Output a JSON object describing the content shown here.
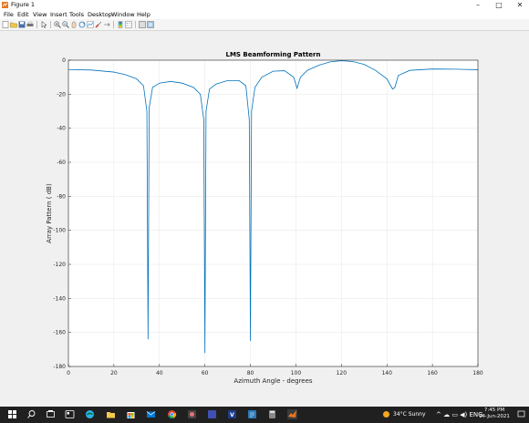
{
  "window": {
    "title": "Figure 1",
    "controls": {
      "minimize": "–",
      "maximize": "□",
      "close": "✕"
    }
  },
  "menu": [
    "File",
    "Edit",
    "View",
    "Insert",
    "Tools",
    "Desktop",
    "Window",
    "Help"
  ],
  "toolbar_icons": [
    "new-figure-icon",
    "open-file-icon",
    "save-icon",
    "print-icon",
    "select-arrow-icon",
    "zoom-in-icon",
    "zoom-out-icon",
    "pan-icon",
    "rotate-3d-icon",
    "data-cursor-icon",
    "brush-icon",
    "link-plot-icon",
    "colorbar-icon",
    "legend-icon",
    "hide-plot-tools-icon",
    "show-plot-tools-icon"
  ],
  "colors": {
    "line": "#0072bd",
    "grid": "#e6e6e6",
    "axes": "#262626",
    "taskbar": "#202020"
  },
  "chart_data": {
    "type": "line",
    "title": "LMS Beamforming Pattern",
    "xlabel": "Azimuth Angle - degrees",
    "ylabel": "Array Pattern ( dB)",
    "xlim": [
      0,
      180
    ],
    "ylim": [
      -180,
      0
    ],
    "xticks": [
      "0",
      "20",
      "40",
      "60",
      "80",
      "100",
      "120",
      "140",
      "160",
      "180"
    ],
    "yticks": [
      "0",
      "-20",
      "-40",
      "-60",
      "-80",
      "-100",
      "-120",
      "-140",
      "-160",
      "-180"
    ],
    "grid": true,
    "series": [
      {
        "x": [
          0,
          10,
          20,
          25,
          30,
          33,
          34.5,
          35,
          35.5,
          37,
          40,
          45,
          50,
          55,
          58,
          59.5,
          60,
          60.5,
          62,
          65,
          70,
          75,
          78,
          79.5,
          80,
          80.5,
          82,
          85,
          90,
          95,
          99,
          100.5,
          102,
          105,
          110,
          115,
          120,
          125,
          130,
          135,
          140,
          142.5,
          143.5,
          145,
          150,
          160,
          170,
          180
        ],
        "y": [
          -5.5,
          -5.8,
          -7,
          -8.5,
          -11,
          -15,
          -30,
          -164,
          -28,
          -16,
          -13.5,
          -12.5,
          -13.5,
          -16,
          -20,
          -35,
          -172,
          -30,
          -17,
          -14,
          -12,
          -12,
          -15,
          -35,
          -165,
          -30,
          -16,
          -10,
          -6.5,
          -6.2,
          -10,
          -16.5,
          -10,
          -6,
          -3,
          -1,
          -0.3,
          -0.8,
          -2.5,
          -6,
          -11,
          -17,
          -16,
          -9,
          -6,
          -5.2,
          -5.3,
          -5.6
        ]
      }
    ]
  },
  "taskbar": {
    "weather": "34°C  Sunny",
    "time": "7:45 PM",
    "date": "14-Jun-2021",
    "apps": [
      "windows-start-icon",
      "search-icon",
      "task-view-icon",
      "widgets-icon",
      "edge-icon",
      "file-explorer-icon",
      "store-icon",
      "mail-icon",
      "chrome-icon",
      "app-icon-1",
      "app-icon-2",
      "vscode-icon",
      "notepad-icon",
      "calculator-icon",
      "app-icon-3",
      "matlab-icon"
    ]
  }
}
